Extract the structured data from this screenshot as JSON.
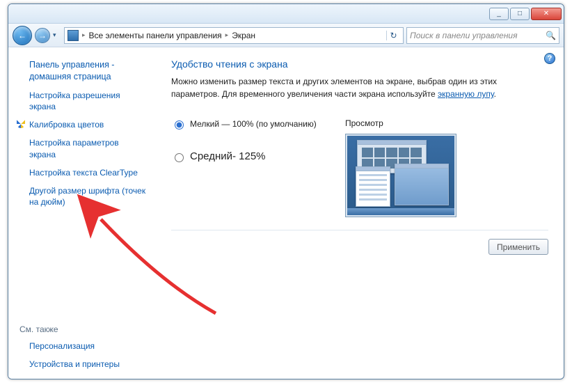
{
  "titlebar": {
    "min": "_",
    "max": "□",
    "close": "✕"
  },
  "nav": {
    "back": "←",
    "fwd": "→",
    "drop": "▾"
  },
  "breadcrumb": {
    "root_sep": "▸",
    "parent": "Все элементы панели управления",
    "sep": "▸",
    "current": "Экран",
    "refresh": "↻"
  },
  "search": {
    "placeholder": "Поиск в панели управления",
    "icon": "🔍"
  },
  "help": {
    "icon": "?"
  },
  "sidebar": {
    "home": "Панель управления - домашняя страница",
    "items": [
      "Настройка разрешения экрана",
      "Калибровка цветов",
      "Настройка параметров экрана",
      "Настройка текста ClearType",
      "Другой размер шрифта (точек на дюйм)"
    ],
    "see_also_label": "См. также",
    "see_also": [
      "Персонализация",
      "Устройства и принтеры"
    ]
  },
  "main": {
    "title": "Удобство чтения с экрана",
    "desc1": "Можно изменить размер текста и других элементов на экране, выбрав один из этих параметров. Для временного увеличения части экрана используйте ",
    "desc_link": "экранную лупу",
    "desc2": ".",
    "opt_small": "Мелкий — 100% (по умолчанию)",
    "opt_medium": "Средний- 125%",
    "preview_label": "Просмотр",
    "apply": "Применить"
  }
}
